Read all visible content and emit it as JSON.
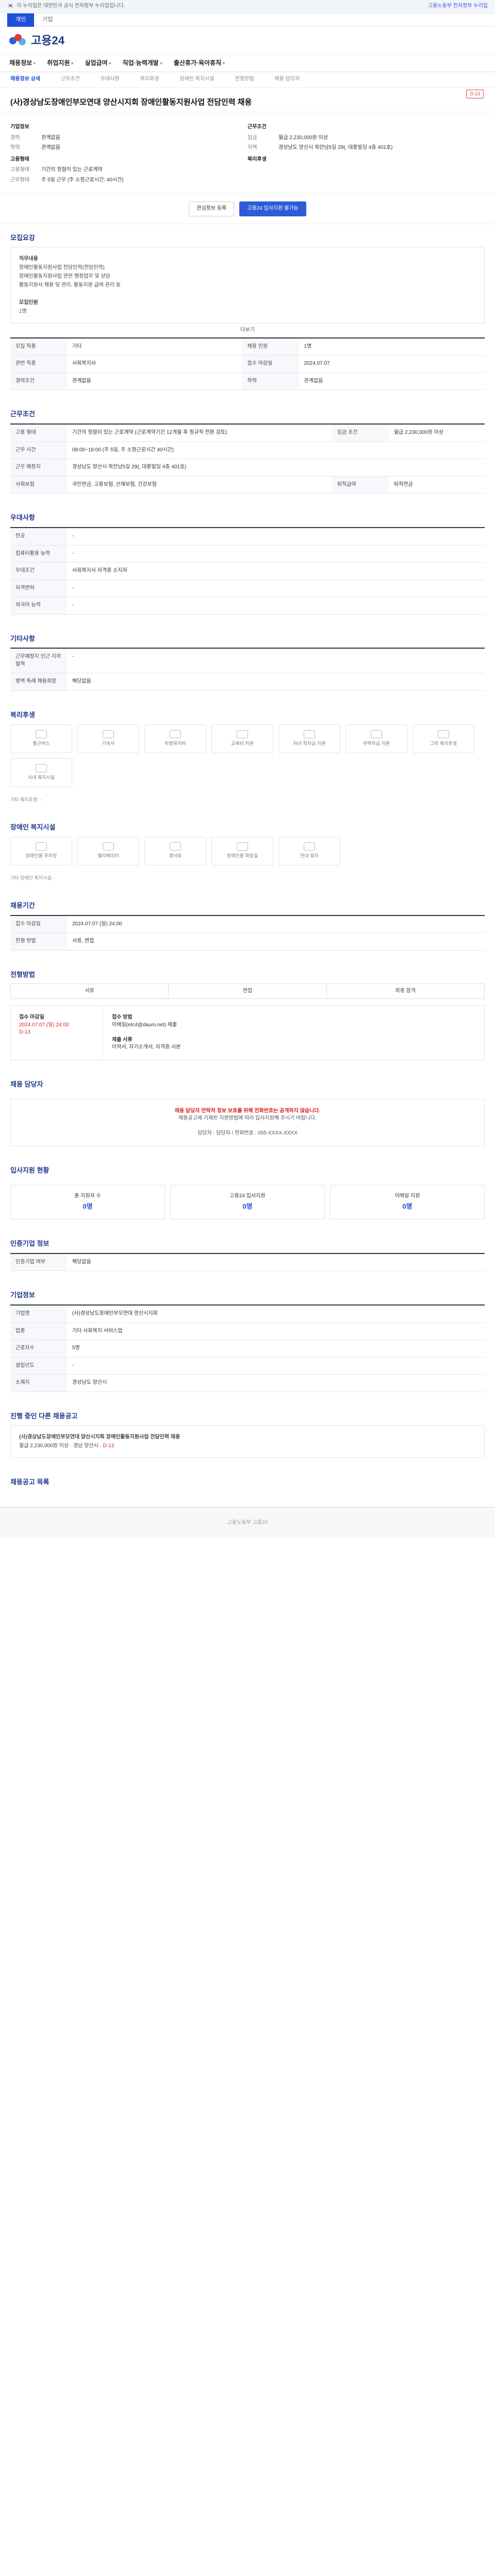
{
  "topbar": {
    "left": "이 누리집은 대한민국 공식 전자정부 누리집입니다.",
    "right": "고용노동부 전자정부 누리집"
  },
  "modes": [
    "개인",
    "기업"
  ],
  "logo": {
    "text": "고용24"
  },
  "nav": [
    "채용정보",
    "취업지원",
    "실업급여",
    "직업·능력개발",
    "출산휴가·육아휴직"
  ],
  "subnav": [
    "채용정보 상세",
    "근무조건",
    "우대사항",
    "복리후생",
    "장애인 복지시설",
    "전형방법",
    "채용 담당자",
    "입사지원 현황",
    "인증기업 정보",
    "기업정보",
    "진행 중인 다른 채용공고",
    "채용공고 목록"
  ],
  "job": {
    "title": "(사)경상남도장애인부모연대 양산시지회 장애인활동지원사업 전담인력 채용",
    "badge": "D-13",
    "company_label": "기업정보",
    "company_name": "(사)경상남도장애인부모연대 양산시지회",
    "cond_label": "근무조건",
    "salary_label": "임금",
    "salary": "월급 2,230,000원 이상",
    "region_label": "지역",
    "region": "경상남도 양산시 북안남5길 29(, 대흥빌딩 4층 401호)",
    "career_label": "경력",
    "career": "관계없음",
    "edu_label": "학력",
    "edu": "관계없음",
    "emp_label": "고용형태",
    "emp_type": "기간의 정함이 있는 근로계약",
    "work_time_label": "근무형태",
    "work_time": "주 5일 근무 (주 소정근로시간: 40시간)",
    "welfare_label": "복리후생"
  },
  "actions": {
    "scrap": "관심정보 등록",
    "apply": "고용24 입사지원 불가능"
  },
  "sections": {
    "detail": "모집요강",
    "cond": "근무조건",
    "pref": "우대사항",
    "etc": "기타사항",
    "welfare": "복리후생",
    "disab": "장애인 복지시설",
    "period": "채용기간",
    "process": "전형방법",
    "contact": "채용 담당자",
    "status": "입사지원 현황",
    "cert": "인증기업 정보",
    "company": "기업정보",
    "other": "진행 중인 다른 채용공고",
    "list": "채용공고 목록"
  },
  "detail": {
    "h1": "직무내용",
    "p1": "장애인활동지원사업 전담인력(전담인력)",
    "p2": "장애인활동지원사업 관련 행정업무 및 상담",
    "p3": "활동지원사 채용 및 관리, 활동지원 급여 관리 등",
    "h2": "모집인원",
    "p4": "1명",
    "more": "더보기"
  },
  "meta": [
    {
      "k": "모집 직종",
      "v": "기타"
    },
    {
      "k": "채용 인원",
      "v": "1명"
    },
    {
      "k": "관련 직종",
      "v": "사회복지사"
    },
    {
      "k": "접수 마감일",
      "v": "2024.07.07"
    },
    {
      "k": "경력조건",
      "v": "관계없음"
    },
    {
      "k": "학력",
      "v": "관계없음"
    }
  ],
  "cond": [
    {
      "k": "고용 형태",
      "v": "기간의 정함이 있는 근로계약 (근로계약기간 12개월 후 정규직 전환 검토)"
    },
    {
      "k": "임금 조건",
      "v": "월급 2,230,000원 이상"
    },
    {
      "k": "근무 시간",
      "v": "09:00~18:00 (주 5일, 주 소정근로시간 40시간)"
    },
    {
      "k": "근무 예정지",
      "v": "경상남도 양산시 북안남5길 29(, 대흥빌딩 4층 401호)"
    },
    {
      "k": "사회보험",
      "v": "국민연금, 고용보험, 산재보험, 건강보험"
    },
    {
      "k": "퇴직급여",
      "v": "퇴직연금"
    }
  ],
  "pref": [
    {
      "k": "전공",
      "v": "-"
    },
    {
      "k": "컴퓨터활용 능력",
      "v": "-"
    },
    {
      "k": "우대조건",
      "v": "사회복지사 자격증 소지자"
    },
    {
      "k": "자격면허",
      "v": "-"
    },
    {
      "k": "외국어 능력",
      "v": "-"
    }
  ],
  "etc": [
    {
      "k": "근무예정지 인근 지하철역",
      "v": "-"
    },
    {
      "k": "병역 특례 채용희망",
      "v": "해당없음"
    }
  ],
  "welfare_items": [
    "통근버스",
    "기숙사",
    "차량유지비",
    "교육비 지원",
    "자녀 학자금 지원",
    "주택자금 지원",
    "그외 복리후생",
    "사내 복지시설"
  ],
  "welfare_note": "기타 복리후생: -",
  "disab_items": [
    "장애인용 주차장",
    "엘리베이터",
    "경사로",
    "장애인용 화장실",
    "안내 점자"
  ],
  "disab_note": "기타 장애인 복지시설: -",
  "period": [
    {
      "k": "접수 마감일",
      "v": "2024.07.07 (일) 24:00"
    },
    {
      "k": "전형 방법",
      "v": "서류, 면접"
    }
  ],
  "process": [
    "서류",
    "면접",
    "최종 합격"
  ],
  "recruit": {
    "dl_label": "접수 마감일",
    "dl": "2024.07.07 (일) 24:00",
    "dday": "D-13",
    "method_label": "접수 방법",
    "method": "이메일(etc4@daum.net) 제출",
    "docs_label": "제출 서류",
    "docs": "이력서, 자기소개서, 자격증 사본"
  },
  "contact": {
    "warn": "채용 담당자 연락처 정보 보호를 위해 전화번호는 공개하지 않습니다.",
    "desc": "채용공고에 기재된 지원방법에 따라 입사지원해 주시기 바랍니다.",
    "name_label": "담당자",
    "name": "담당자",
    "phone_label": "전화번호",
    "phone": "055-XXXX-XXXX"
  },
  "status": [
    {
      "k": "총 지원자 수",
      "v": "0명"
    },
    {
      "k": "고용24 입사지원",
      "v": "0명"
    },
    {
      "k": "이메일 지원",
      "v": "0명"
    }
  ],
  "cert": {
    "k": "인증기업 여부",
    "v": "해당없음"
  },
  "company": [
    {
      "k": "기업명",
      "v": "(사)경상남도장애인부모연대 양산시지회"
    },
    {
      "k": "업종",
      "v": "기타 사회복지 서비스업"
    },
    {
      "k": "근로자수",
      "v": "5명"
    },
    {
      "k": "설립년도",
      "v": "-"
    },
    {
      "k": "소재지",
      "v": "경상남도 양산시"
    }
  ],
  "other": {
    "title": "(사)경상남도장애인부모연대 양산시지회 장애인활동지원사업 전담인력 채용",
    "salary": "월급 2,230,000원 이상",
    "region": "경남 양산시",
    "dday": "D-13"
  },
  "footer": "고용노동부 고용24"
}
